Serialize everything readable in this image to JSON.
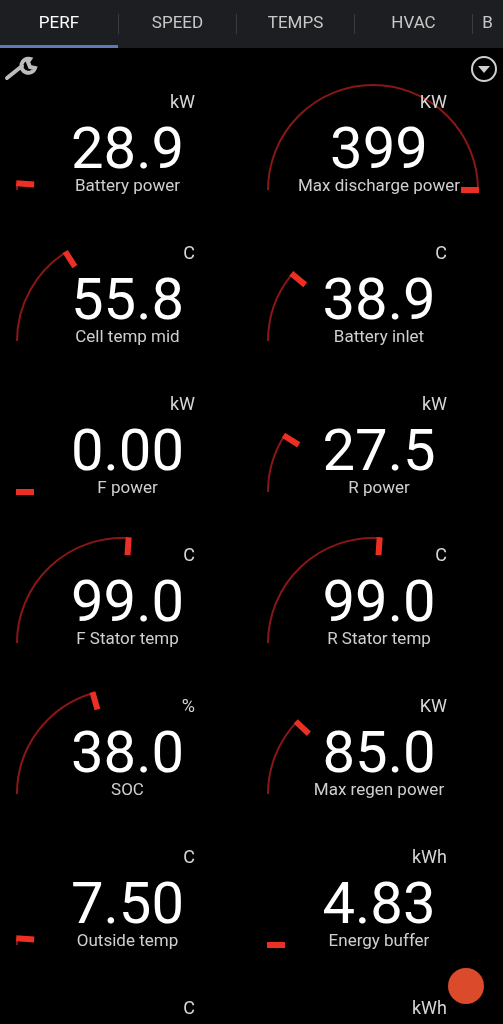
{
  "tabs": [
    {
      "label": "PERF",
      "selected": true
    },
    {
      "label": "SPEED",
      "selected": false
    },
    {
      "label": "TEMPS",
      "selected": false
    },
    {
      "label": "HVAC",
      "selected": false
    },
    {
      "label": "B",
      "selected": false
    }
  ],
  "gauges": [
    {
      "unit": "kW",
      "value": "28.9",
      "label": "Battery power"
    },
    {
      "unit": "KW",
      "value": "399",
      "label": "Max discharge power"
    },
    {
      "unit": "C",
      "value": "55.8",
      "label": "Cell temp mid"
    },
    {
      "unit": "C",
      "value": "38.9",
      "label": "Battery inlet"
    },
    {
      "unit": "kW",
      "value": "0.00",
      "label": "F power"
    },
    {
      "unit": "kW",
      "value": "27.5",
      "label": "R power"
    },
    {
      "unit": "C",
      "value": "99.0",
      "label": "F Stator temp"
    },
    {
      "unit": "C",
      "value": "99.0",
      "label": "R Stator temp"
    },
    {
      "unit": "%",
      "value": "38.0",
      "label": "SOC"
    },
    {
      "unit": "KW",
      "value": "85.0",
      "label": "Max regen power"
    },
    {
      "unit": "C",
      "value": "7.50",
      "label": "Outside temp"
    },
    {
      "unit": "kWh",
      "value": "4.83",
      "label": "Energy buffer"
    },
    {
      "unit": "C"
    },
    {
      "unit": "kWh"
    }
  ]
}
